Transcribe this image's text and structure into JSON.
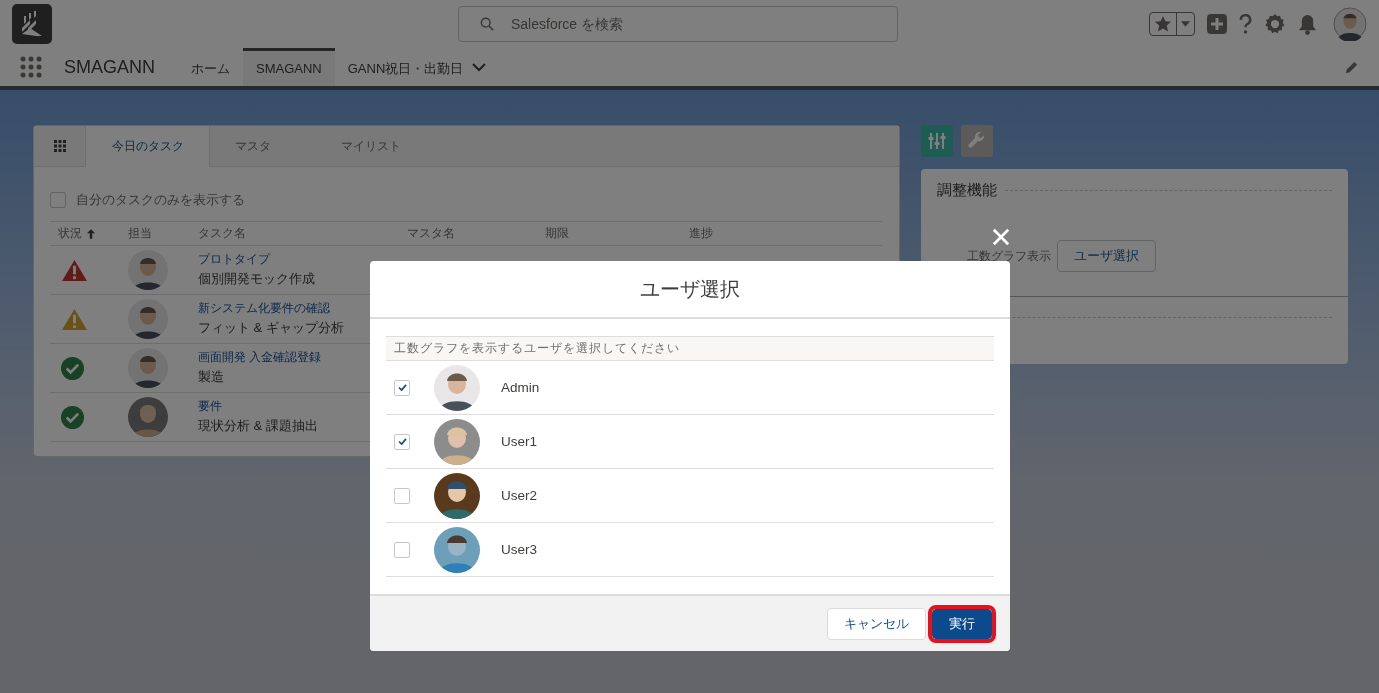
{
  "header": {
    "search_placeholder": "Salesforce を検索"
  },
  "nav": {
    "app_name": "SMAGANN",
    "tabs": [
      {
        "label": "ホーム",
        "selected": false
      },
      {
        "label": "SMAGANN",
        "selected": true
      },
      {
        "label": "GANN祝日・出勤日",
        "selected": false
      }
    ]
  },
  "task_card": {
    "tabs": [
      {
        "label": "今日のタスク",
        "selected": true
      },
      {
        "label": "マスタ",
        "selected": false
      },
      {
        "label": "マイリスト",
        "selected": false
      }
    ],
    "filter": {
      "label": "自分のタスクのみを表示する",
      "checked": false
    },
    "columns": [
      "状況",
      "担当",
      "タスク名",
      "マスタ名",
      "期限",
      "進捗"
    ],
    "rows": [
      {
        "kind": "error",
        "category": "プロトタイプ",
        "task": "個別開発モック作成"
      },
      {
        "kind": "warning",
        "category": "新システム化要件の確認",
        "task": "フィット & ギャップ分析"
      },
      {
        "kind": "done",
        "category": "画面開発 入金確認登録",
        "task": "製造"
      },
      {
        "kind": "done",
        "category": "要件",
        "task": "現状分析 & 課題抽出"
      }
    ]
  },
  "side_panel": {
    "tools": [
      {
        "kind": "sliders",
        "selected": true
      },
      {
        "kind": "wrench",
        "selected": false
      }
    ],
    "title": "調整機能",
    "field_label": "工数グラフ表示",
    "button": "ユーザ選択"
  },
  "modal": {
    "title": "ユーザ選択",
    "instruction": "工数グラフを表示するユーザを選択してください",
    "users": [
      {
        "name": "Admin",
        "checked": true
      },
      {
        "name": "User1",
        "checked": true
      },
      {
        "name": "User2",
        "checked": false
      },
      {
        "name": "User3",
        "checked": false
      }
    ],
    "buttons": [
      {
        "label": "キャンセル",
        "kind": "neutral",
        "highlighted": false
      },
      {
        "label": "実行",
        "kind": "brand",
        "highlighted": true
      }
    ]
  }
}
